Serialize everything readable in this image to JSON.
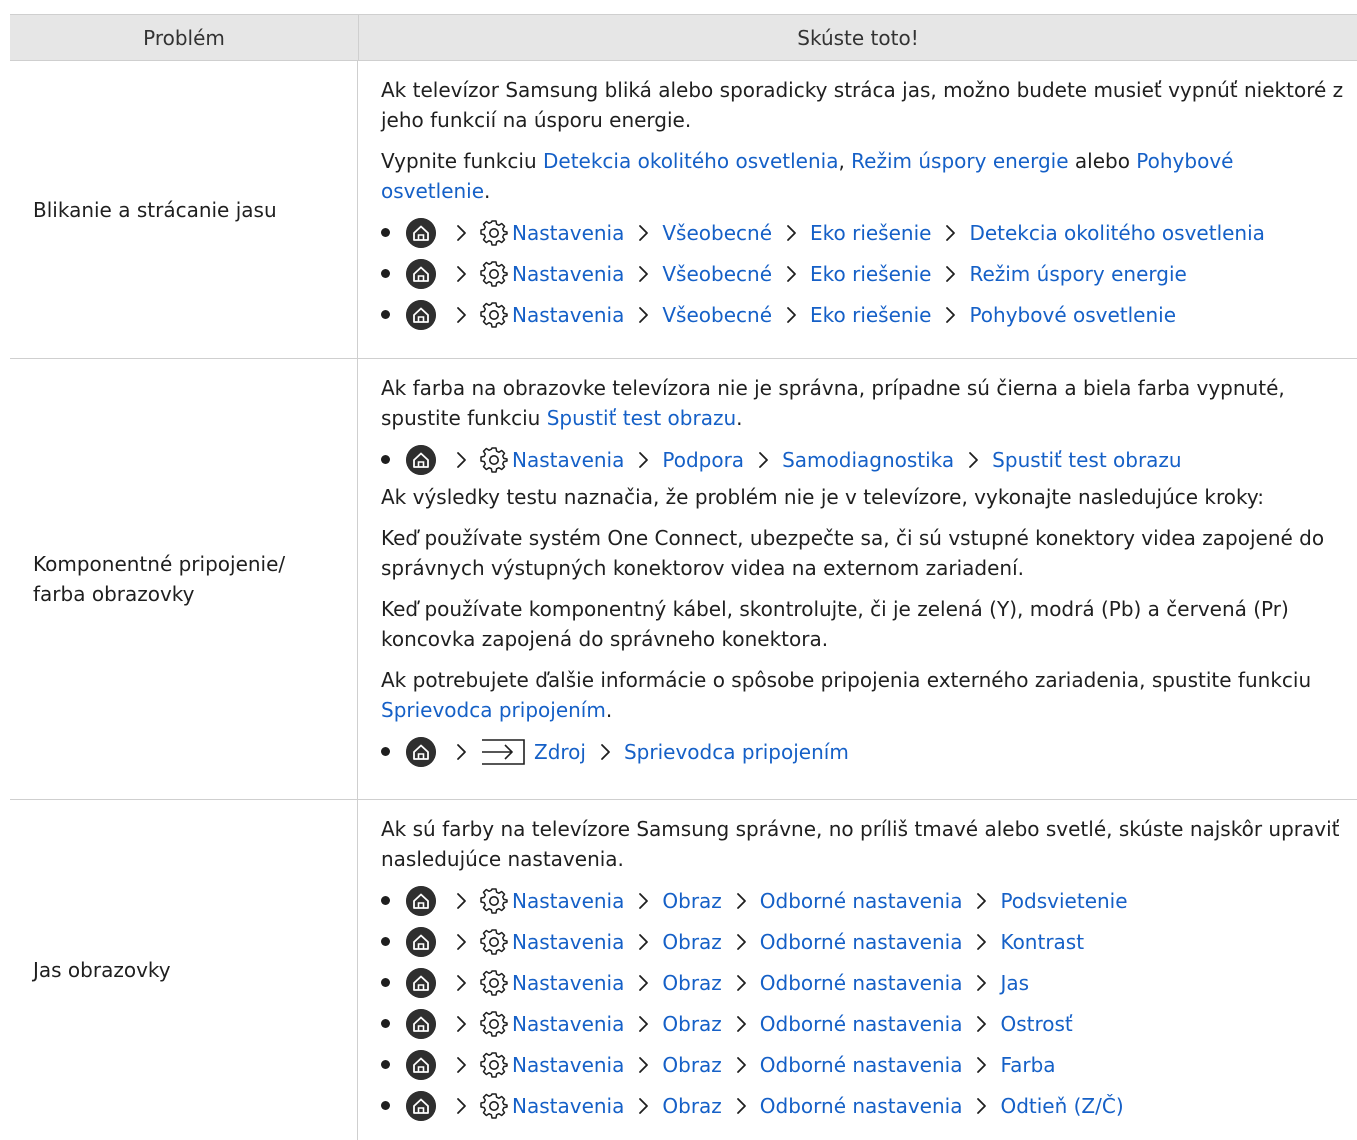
{
  "header": {
    "col1": "Problém",
    "col2": "Skúste toto!"
  },
  "rows": [
    {
      "problem": "Blikanie a strácanie jasu",
      "p1": "Ak televízor Samsung bliká alebo sporadicky stráca jas, možno budete musieť vypnúť niektoré z jeho funkcií na úsporu energie.",
      "p2": {
        "t1": "Vypnite funkciu ",
        "l1": "Detekcia okolitého osvetlenia",
        "t2": ", ",
        "l2": "Režim úspory energie",
        "t3": " alebo ",
        "l3": "Pohybové osvetlenie",
        "t4": "."
      },
      "paths": [
        [
          "Nastavenia",
          "Všeobecné",
          "Eko riešenie",
          "Detekcia okolitého osvetlenia"
        ],
        [
          "Nastavenia",
          "Všeobecné",
          "Eko riešenie",
          "Režim úspory energie"
        ],
        [
          "Nastavenia",
          "Všeobecné",
          "Eko riešenie",
          "Pohybové osvetlenie"
        ]
      ]
    },
    {
      "problem": "Komponentné pripojenie/ farba obrazovky",
      "p1": {
        "t1": "Ak farba na obrazovke televízora nie je správna, prípadne sú čierna a biela farba vypnuté, spustite funkciu ",
        "l1": "Spustiť test obrazu",
        "t2": "."
      },
      "path1": [
        "Nastavenia",
        "Podpora",
        "Samodiagnostika",
        "Spustiť test obrazu"
      ],
      "p2": "Ak výsledky testu naznačia, že problém nie je v televízore, vykonajte nasledujúce kroky:",
      "p3": "Keď používate systém One Connect, ubezpečte sa, či sú vstupné konektory videa zapojené do správnych výstupných konektorov videa na externom zariadení.",
      "p4": "Keď používate komponentný kábel, skontrolujte, či je zelená (Y), modrá (Pb) a červená (Pr) koncovka zapojená do správneho konektora.",
      "p5": {
        "t1": "Ak potrebujete ďalšie informácie o spôsobe pripojenia externého zariadenia, spustite funkciu ",
        "l1": "Sprievodca pripojením",
        "t2": "."
      },
      "path2": [
        "Zdroj",
        "Sprievodca pripojením"
      ]
    },
    {
      "problem": "Jas obrazovky",
      "p1": "Ak sú farby na televízore Samsung správne, no príliš tmavé alebo svetlé, skúste najskôr upraviť nasledujúce nastavenia.",
      "paths": [
        [
          "Nastavenia",
          "Obraz",
          "Odborné nastavenia",
          "Podsvietenie"
        ],
        [
          "Nastavenia",
          "Obraz",
          "Odborné nastavenia",
          "Kontrast"
        ],
        [
          "Nastavenia",
          "Obraz",
          "Odborné nastavenia",
          "Jas"
        ],
        [
          "Nastavenia",
          "Obraz",
          "Odborné nastavenia",
          "Ostrosť"
        ],
        [
          "Nastavenia",
          "Obraz",
          "Odborné nastavenia",
          "Farba"
        ],
        [
          "Nastavenia",
          "Obraz",
          "Odborné nastavenia",
          "Odtieň (Z/Č)"
        ]
      ]
    }
  ],
  "icons": {
    "home": "home-icon",
    "settings": "gear-icon",
    "source": "source-input-icon",
    "separator": "chevron-right-icon"
  },
  "colors": {
    "link": "#1560c7",
    "header_bg": "#e6e6e6",
    "border": "#cfcfcf",
    "text": "#1f1f1f"
  }
}
